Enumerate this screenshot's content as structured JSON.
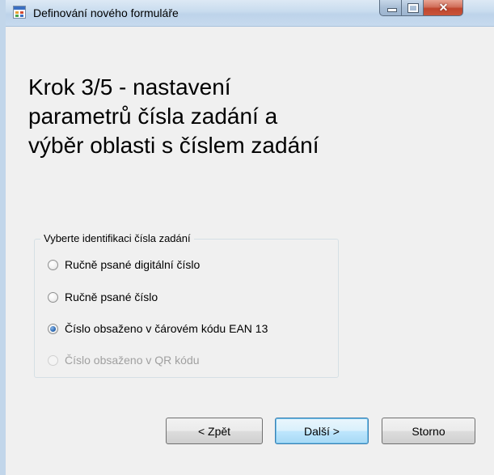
{
  "window": {
    "title": "Definování nového formuláře"
  },
  "page": {
    "heading": "Krok 3/5 - nastavení parametrů čísla zadání a výběr oblasti s číslem zadání"
  },
  "group": {
    "legend": "Vyberte identifikaci čísla zadání",
    "options": [
      {
        "label": "Ručně psané digitální číslo",
        "checked": false,
        "enabled": true
      },
      {
        "label": "Ručně psané číslo",
        "checked": false,
        "enabled": true
      },
      {
        "label": "Číslo obsaženo v čárovém kódu EAN 13",
        "checked": true,
        "enabled": true
      },
      {
        "label": "Číslo obsaženo v QR kódu",
        "checked": false,
        "enabled": false
      }
    ]
  },
  "buttons": {
    "back": "< Zpět",
    "next": "Další >",
    "cancel": "Storno"
  },
  "colors": {
    "radio_checked": "#2d6bb5",
    "disabled_text": "#a0a0a0",
    "default_button_border": "#3c7fb1"
  }
}
